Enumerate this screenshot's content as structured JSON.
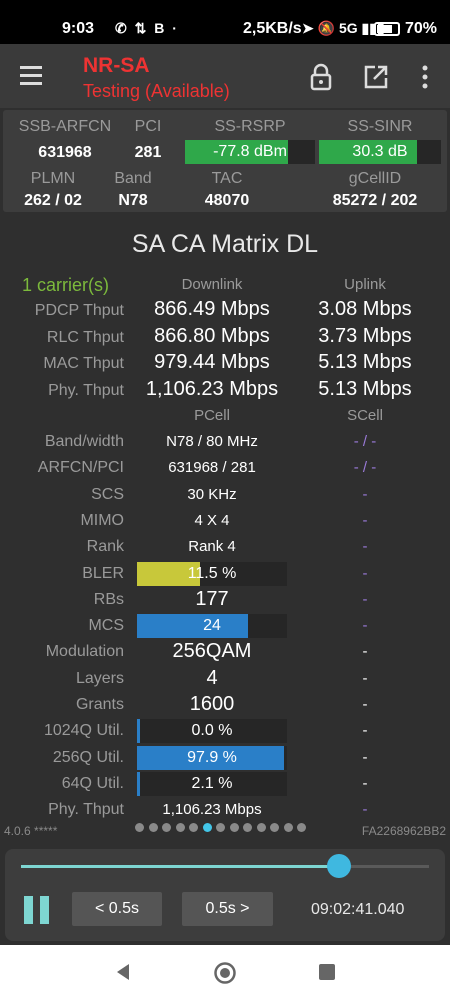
{
  "status_bar": {
    "time": "9:03",
    "left_icons": "✆ ⇅ B ·",
    "speed": "2,5KB/s",
    "right_icons": "➤ 🔕 5G ▮▮▮",
    "battery_pct": "70%"
  },
  "toolbar": {
    "title": "NR-SA",
    "subtitle": "Testing (Available)",
    "icons": [
      "menu-icon",
      "lock-icon",
      "open-external-icon",
      "more-vert-icon"
    ]
  },
  "cell_info": {
    "headers1": [
      "SSB-ARFCN",
      "PCI",
      "SS-RSRP",
      "SS-SINR"
    ],
    "arfcn": "631968",
    "pci": "281",
    "rsrp": "-77.8 dBm",
    "rsrp_level": 0.79,
    "sinr": "30.3 dB",
    "sinr_level": 0.8,
    "headers2": [
      "PLMN",
      "Band",
      "TAC",
      "gCellID"
    ],
    "plmn": "262 / 02",
    "band": "N78",
    "tac": "48070",
    "gcellid": "85272 / 202"
  },
  "matrix": {
    "title": "SA CA Matrix DL",
    "carriers": "1 carrier(s)",
    "col_dl": "Downlink",
    "col_ul": "Uplink",
    "throughput": [
      {
        "label": "PDCP Thput",
        "dl": "866.49 Mbps",
        "ul": "3.08 Mbps"
      },
      {
        "label": "RLC Thput",
        "dl": "866.80 Mbps",
        "ul": "3.73 Mbps"
      },
      {
        "label": "MAC Thput",
        "dl": "979.44 Mbps",
        "ul": "5.13 Mbps"
      },
      {
        "label": "Phy. Thput",
        "dl": "1,106.23 Mbps",
        "ul": "5.13 Mbps"
      }
    ],
    "col_pcell": "PCell",
    "col_scell": "SCell",
    "rows": [
      {
        "label": "Band/width",
        "pcell": "N78 / 80 MHz",
        "scell": "- / -"
      },
      {
        "label": "ARFCN/PCI",
        "pcell": "631968 / 281",
        "scell": "- / -"
      },
      {
        "label": "SCS",
        "pcell": "30 KHz",
        "scell": "-"
      },
      {
        "label": "MIMO",
        "pcell": "4 X 4",
        "scell": "-"
      },
      {
        "label": "Rank",
        "pcell": "Rank 4",
        "scell": "-"
      },
      {
        "label": "BLER",
        "pcell": "11.5 %",
        "scell": "-",
        "level": 0.42,
        "color": "#c8c83a"
      },
      {
        "label": "RBs",
        "pcell": "177",
        "scell": "-"
      },
      {
        "label": "MCS",
        "pcell": "24",
        "scell": "-",
        "level": 0.74,
        "color": "#2a7fc8"
      },
      {
        "label": "Modulation",
        "pcell": "256QAM",
        "scell": "-"
      },
      {
        "label": "Layers",
        "pcell": "4",
        "scell": "-"
      },
      {
        "label": "Grants",
        "pcell": "1600",
        "scell": "-"
      },
      {
        "label": "1024Q Util.",
        "pcell": "0.0 %",
        "scell": "-",
        "level": 0.02,
        "color": "#2a7fc8"
      },
      {
        "label": "256Q Util.",
        "pcell": "97.9 %",
        "scell": "-",
        "level": 0.979,
        "color": "#2a7fc8"
      },
      {
        "label": "64Q Util.",
        "pcell": "2.1 %",
        "scell": "-",
        "level": 0.021,
        "color": "#2a7fc8"
      },
      {
        "label": "Phy. Thput",
        "pcell": "1,106.23 Mbps",
        "scell": "-"
      }
    ]
  },
  "footer": {
    "version": "4.0.6 *****",
    "device_id": "FA2268962BB2",
    "page_count": 13,
    "active_page": 5
  },
  "player": {
    "progress": 0.78,
    "back_label": "< 0.5s",
    "forward_label": "0.5s >",
    "time": "09:02:41.040"
  },
  "nav": {
    "icons": [
      "back-icon",
      "home-icon",
      "recents-icon"
    ]
  }
}
